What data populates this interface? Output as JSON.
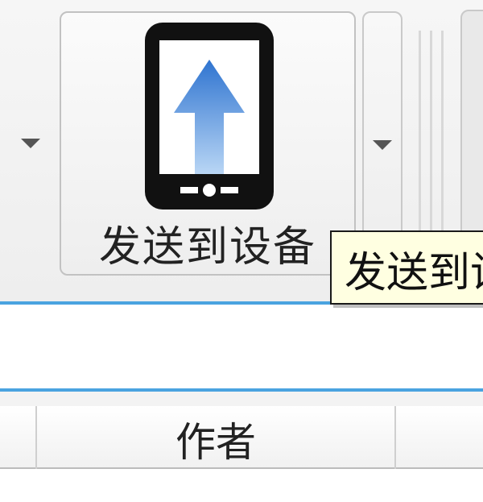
{
  "toolbar": {
    "send_button_label": "发送到设备",
    "tooltip_text": "发送到设备",
    "icon": "send-to-device-icon",
    "arrow_color": "#3a84d8",
    "device_color": "#111111"
  },
  "table": {
    "columns": [
      "",
      "作者",
      ""
    ]
  },
  "colors": {
    "accent_rule": "#4aa3e0",
    "tooltip_bg": "#ffffe1"
  }
}
